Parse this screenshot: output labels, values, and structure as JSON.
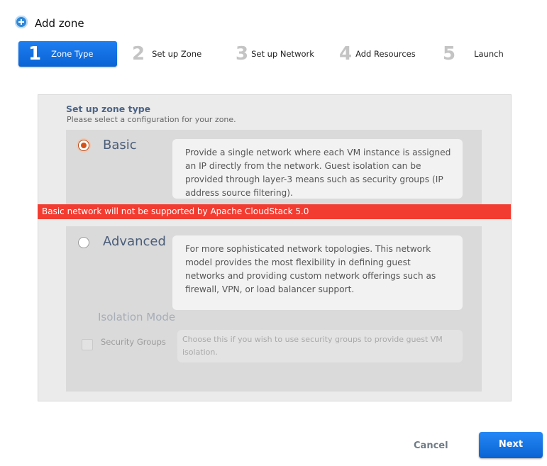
{
  "header": {
    "title": "Add zone",
    "icon": "add-circle-icon"
  },
  "steps": [
    {
      "num": "1",
      "label": "Zone Type"
    },
    {
      "num": "2",
      "label": "Set up Zone"
    },
    {
      "num": "3",
      "label": "Set up Network"
    },
    {
      "num": "4",
      "label": "Add Resources"
    },
    {
      "num": "5",
      "label": "Launch"
    }
  ],
  "form": {
    "title": "Set up zone type",
    "subtitle": "Please select a configuration for your zone.",
    "options": {
      "basic": {
        "label": "Basic",
        "selected": true,
        "description": "Provide a single network where each VM instance is assigned an IP directly from the network. Guest isolation can be provided through layer-3 means such as security groups (IP address source filtering)."
      },
      "advanced": {
        "label": "Advanced",
        "selected": false,
        "description": "For more sophisticated network topologies. This network model provides the most flexibility in defining guest networks and providing custom network offerings such as firewall, VPN, or load balancer support."
      }
    },
    "warning": "Basic network will not be supported by Apache CloudStack 5.0",
    "isolation": {
      "title": "Isolation Mode",
      "checkbox_label": "Security Groups",
      "checkbox_checked": false,
      "checkbox_description": "Choose this if you wish to use security groups to provide guest VM isolation."
    }
  },
  "buttons": {
    "cancel": "Cancel",
    "next": "Next"
  },
  "colors": {
    "active_step": "#0a63d3",
    "warning": "#f33c31",
    "selected_radio": "#d5521b"
  }
}
